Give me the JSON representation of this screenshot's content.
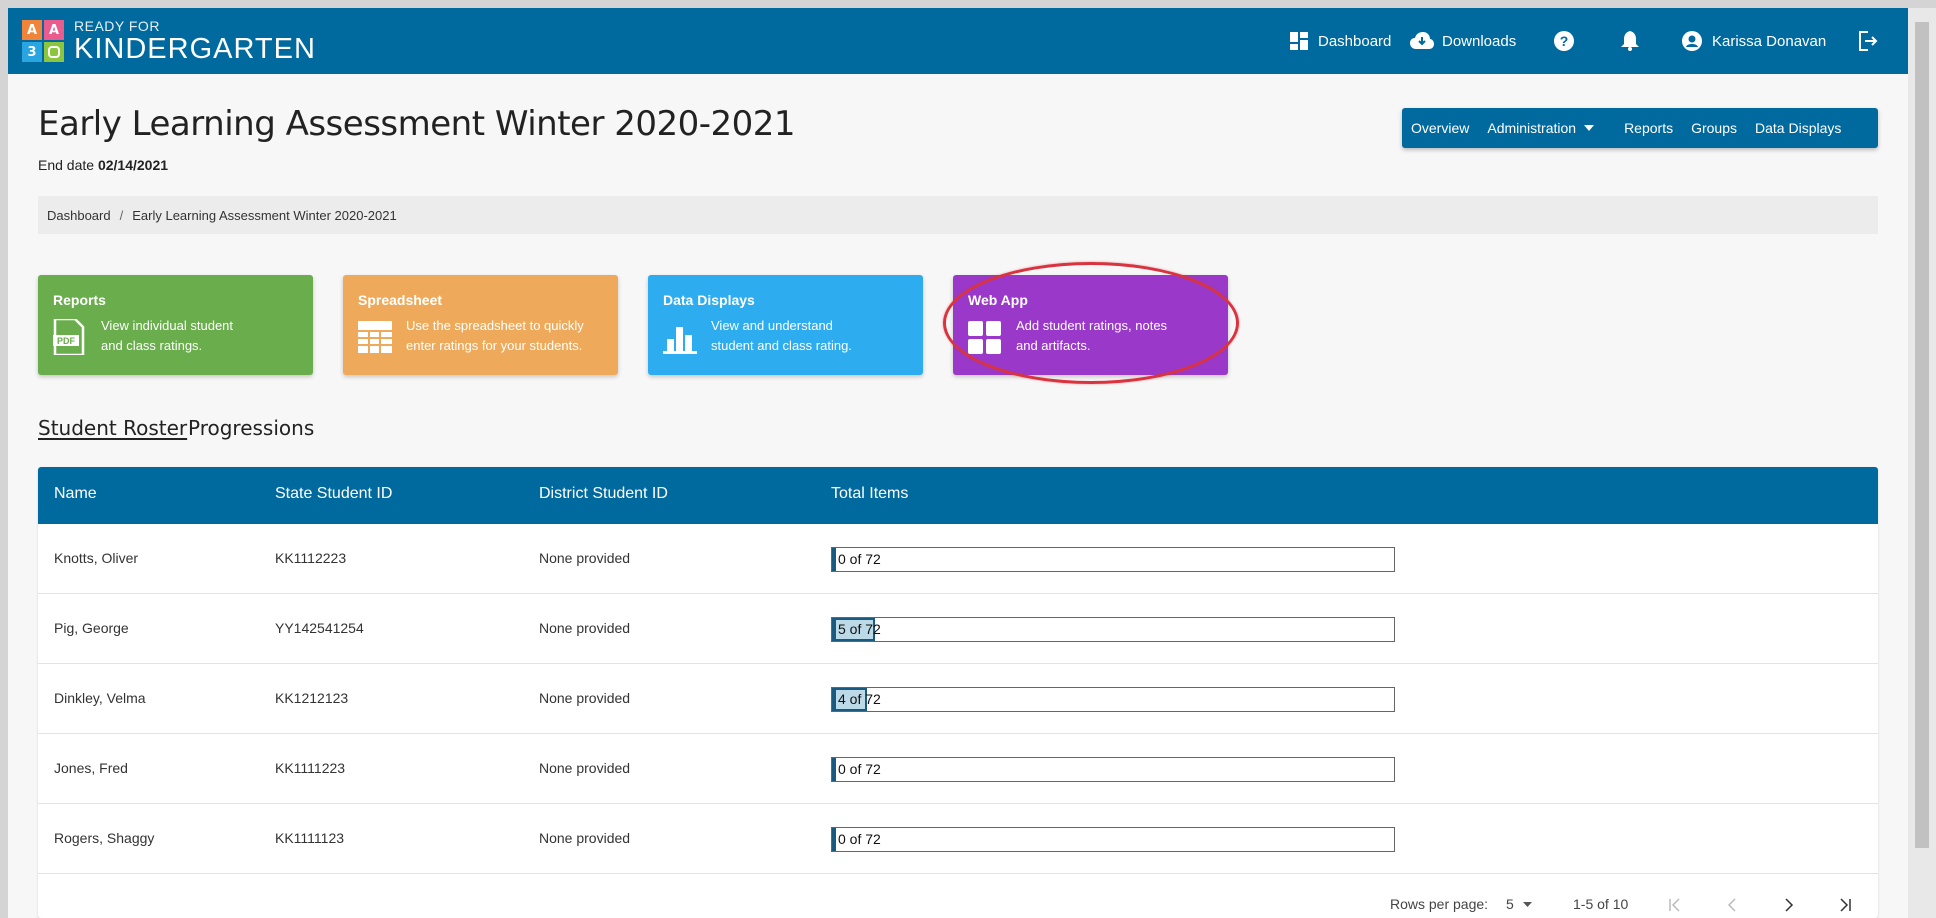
{
  "app": {
    "logo_blocks": [
      "A",
      "A",
      "3",
      ""
    ],
    "logo_small": "READY FOR",
    "logo_big": "KINDERGARTEN"
  },
  "topnav": {
    "dashboard": "Dashboard",
    "downloads": "Downloads",
    "user": "Karissa Donavan"
  },
  "page": {
    "title": "Early Learning Assessment Winter 2020-2021",
    "end_date_label": "End date",
    "end_date": "02/14/2021"
  },
  "subnav": [
    "Overview",
    "Administration",
    "Reports",
    "Groups",
    "Data Displays"
  ],
  "breadcrumb": [
    "Dashboard",
    "Early Learning Assessment Winter 2020-2021"
  ],
  "cards": [
    {
      "title": "Reports",
      "desc1": "View individual student",
      "desc2": "and class ratings.",
      "color": "#6aad4c",
      "icon": "pdf-icon"
    },
    {
      "title": "Spreadsheet",
      "desc1": "Use the spreadsheet to quickly",
      "desc2": "enter ratings for your students.",
      "color": "#eeaa5a",
      "icon": "table-grid-icon"
    },
    {
      "title": "Data Displays",
      "desc1": "View and understand",
      "desc2": "student and class rating.",
      "color": "#2dacf0",
      "icon": "bar-chart-icon"
    },
    {
      "title": "Web App",
      "desc1": "Add student ratings, notes",
      "desc2": "and artifacts.",
      "color": "#9a38c9",
      "icon": "app-grid-icon"
    }
  ],
  "tabs": [
    "Student Roster",
    "Progressions"
  ],
  "table": {
    "headers": [
      "Name",
      "State Student ID",
      "District Student ID",
      "Total Items"
    ],
    "rows": [
      {
        "name": "Knotts, Oliver",
        "state_id": "KK1112223",
        "district_id": "None provided",
        "progress": "0 of 72",
        "completed": 0
      },
      {
        "name": "Pig, George",
        "state_id": "YY142541254",
        "district_id": "None provided",
        "progress": "5 of 72",
        "completed": 5
      },
      {
        "name": "Dinkley, Velma",
        "state_id": "KK1212123",
        "district_id": "None provided",
        "progress": "4 of 72",
        "completed": 4
      },
      {
        "name": "Jones, Fred",
        "state_id": "KK1111223",
        "district_id": "None provided",
        "progress": "0 of 72",
        "completed": 0
      },
      {
        "name": "Rogers, Shaggy",
        "state_id": "KK1111123",
        "district_id": "None provided",
        "progress": "0 of 72",
        "completed": 0
      }
    ],
    "total_items": 72
  },
  "pager": {
    "rows_label": "Rows per page:",
    "rows_value": "5",
    "range": "1-5 of 10"
  },
  "colors": {
    "brand_blue": "#00699e",
    "highlight_red": "#d9333f"
  }
}
